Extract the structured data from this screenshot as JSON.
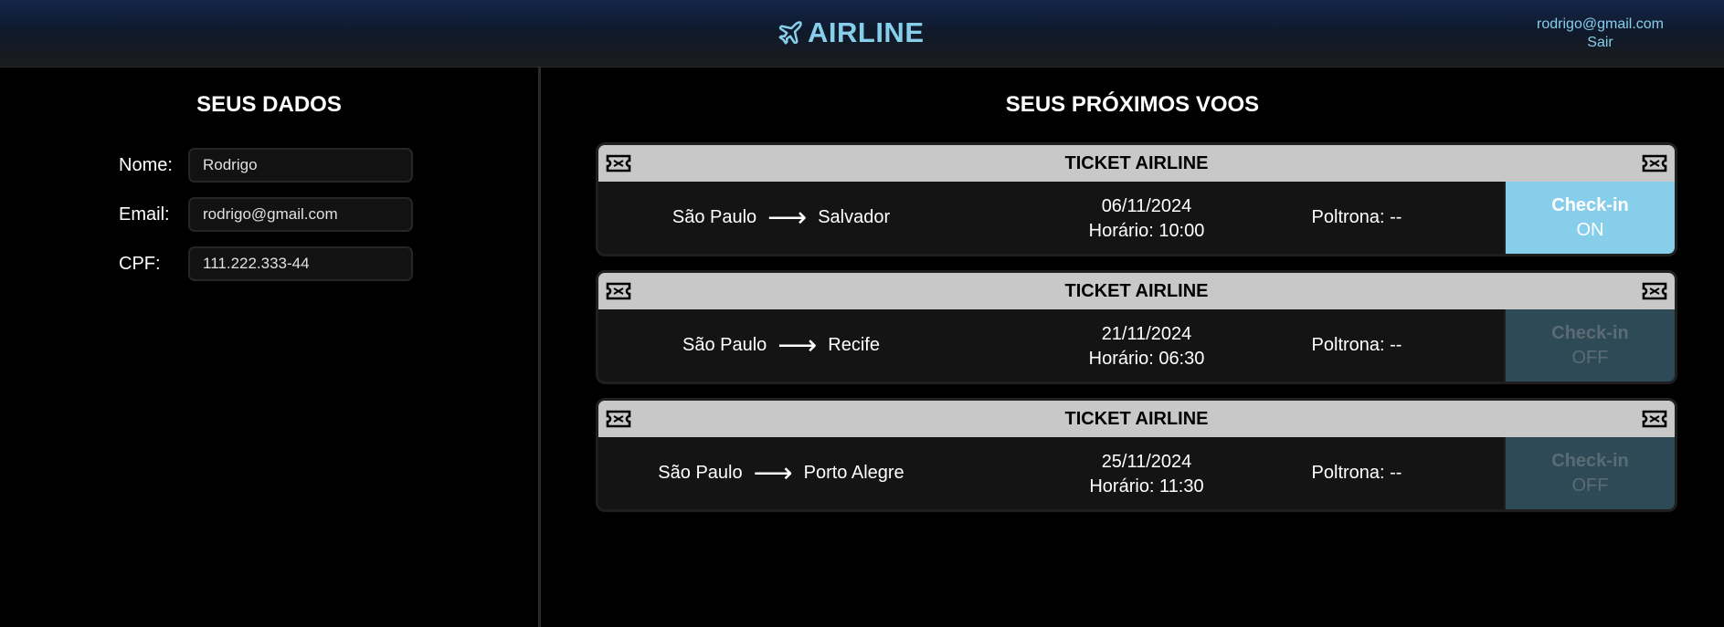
{
  "header": {
    "brand": "AIRLINE",
    "user_email": "rodrigo@gmail.com",
    "logout_label": "Sair"
  },
  "profile": {
    "title": "SEUS DADOS",
    "fields": [
      {
        "label": "Nome:",
        "value": "Rodrigo"
      },
      {
        "label": "Email:",
        "value": "rodrigo@gmail.com"
      },
      {
        "label": "CPF:",
        "value": "111.222.333-44"
      }
    ]
  },
  "flights": {
    "title": "SEUS PRÓXIMOS VOOS",
    "tickets": [
      {
        "header": "TICKET AIRLINE",
        "origin": "São Paulo",
        "arrow": "⟶",
        "destination": "Salvador",
        "date": "06/11/2024",
        "time": "Horário: 10:00",
        "seat": "Poltrona: --",
        "checkin_label": "Check-in",
        "checkin_state": "ON"
      },
      {
        "header": "TICKET AIRLINE",
        "origin": "São Paulo",
        "arrow": "⟶",
        "destination": "Recife",
        "date": "21/11/2024",
        "time": "Horário: 06:30",
        "seat": "Poltrona: --",
        "checkin_label": "Check-in",
        "checkin_state": "OFF"
      },
      {
        "header": "TICKET AIRLINE",
        "origin": "São Paulo",
        "arrow": "⟶",
        "destination": "Porto Alegre",
        "date": "25/11/2024",
        "time": "Horário: 11:30",
        "seat": "Poltrona: --",
        "checkin_label": "Check-in",
        "checkin_state": "OFF"
      }
    ]
  },
  "colors": {
    "accent": "#87ceeb",
    "checkin_off": "#2e4a57",
    "ticket_header": "#c8c8c8"
  },
  "icons": {
    "brand": "plane-icon",
    "ticket": "ticket-icon"
  }
}
